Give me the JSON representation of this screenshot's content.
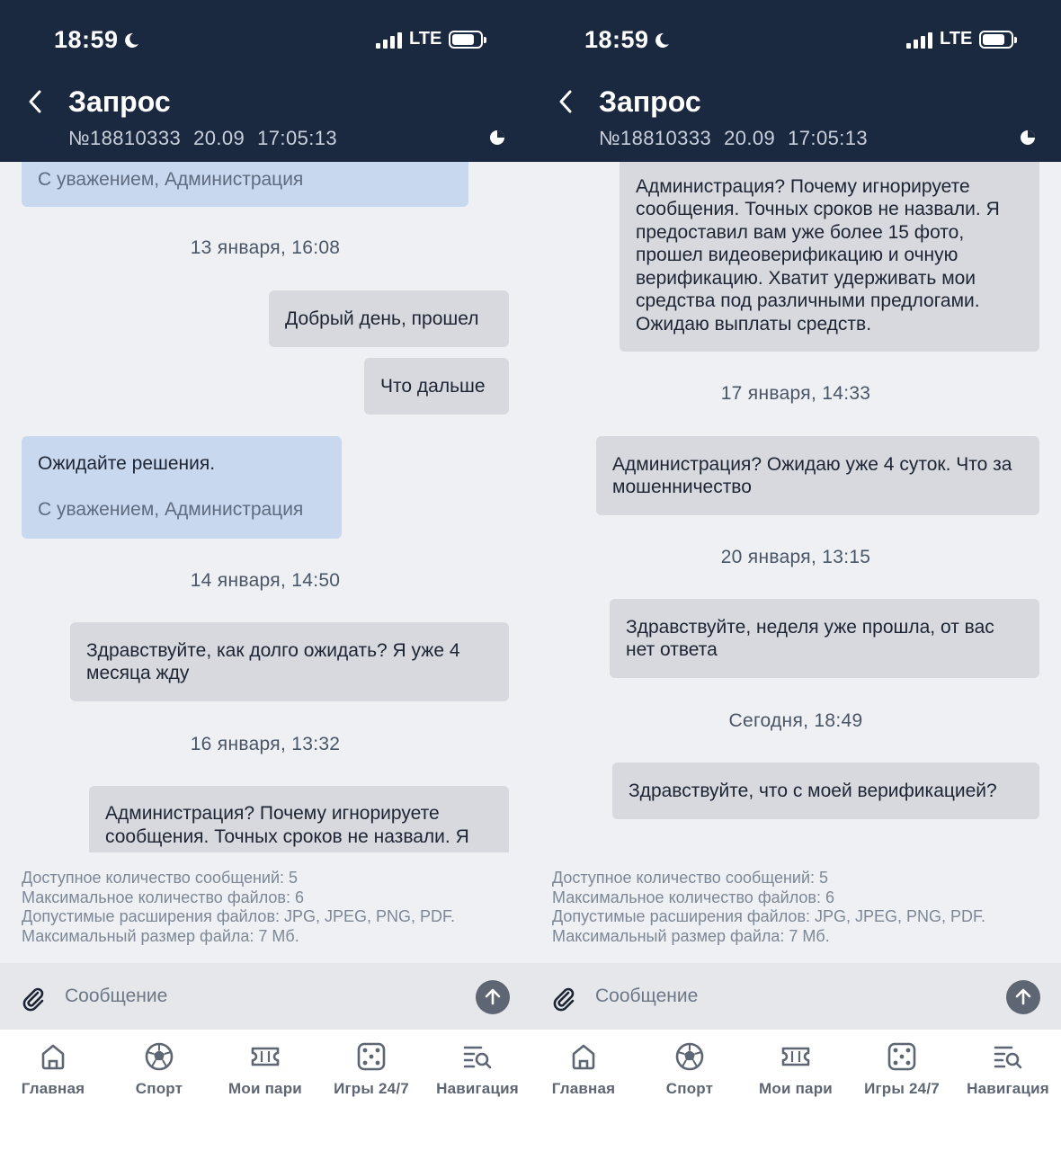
{
  "status_bar": {
    "time": "18:59",
    "network": "LTE"
  },
  "header": {
    "title": "Запрос",
    "ticket_number": "№18810333",
    "date": "20.09",
    "time": "17:05:13"
  },
  "left_chat": {
    "msg_top_sign": "С уважением, Администрация",
    "sep1": "13 января, 16:08",
    "msg_good_day": "Добрый день, прошел",
    "msg_what_next": "Что дальше",
    "msg_wait_text": "Ожидайте решения.",
    "msg_wait_sign": "С уважением, Администрация",
    "sep2": "14 января, 14:50",
    "msg_how_long": "Здравствуйте, как долго ожидать? Я уже 4 месяца жду",
    "sep3": "16 января, 13:32",
    "msg_admin_partial": "Администрация? Почему игнорируете сообщения. Точных сроков не назвали. Я"
  },
  "right_chat": {
    "msg_admin_full": "Администрация? Почему игнорируете сообщения. Точных сроков не назвали. Я предоставил вам уже более 15 фото, прошел видеоверификацию и очную верификацию. Хватит удерживать мои средства под различными предлогами. Ожидаю выплаты средств.",
    "sep1": "17 января, 14:33",
    "msg_4_days": "Администрация? Ожидаю уже 4 суток. Что за мошенничество",
    "sep2": "20 января, 13:15",
    "msg_week": "Здравствуйте, неделя уже прошла, от вас нет ответа",
    "sep3": "Сегодня, 18:49",
    "msg_verification": "Здравствуйте, что с моей верификацией?"
  },
  "info": {
    "line1": "Доступное количество сообщений: 5",
    "line2": "Максимальное количество файлов: 6",
    "line3": "Допустимые расширения файлов: JPG, JPEG, PNG, PDF.",
    "line4": "Максимальный размер файла: 7 Мб."
  },
  "composer": {
    "placeholder": "Сообщение"
  },
  "tabs": [
    {
      "label": "Главная",
      "icon": "home-icon"
    },
    {
      "label": "Спорт",
      "icon": "soccer-ball-icon"
    },
    {
      "label": "Мои пари",
      "icon": "ticket-icon"
    },
    {
      "label": "Игры 24/7",
      "icon": "dice-icon"
    },
    {
      "label": "Навигация",
      "icon": "navigation-search-icon"
    }
  ],
  "colors": {
    "header_bg": "#1b2940",
    "incoming_bubble": "#c8d8ee",
    "outgoing_bubble": "#d7d9de",
    "chat_bg": "#eef0f3",
    "tab_icon": "#5e6673"
  }
}
